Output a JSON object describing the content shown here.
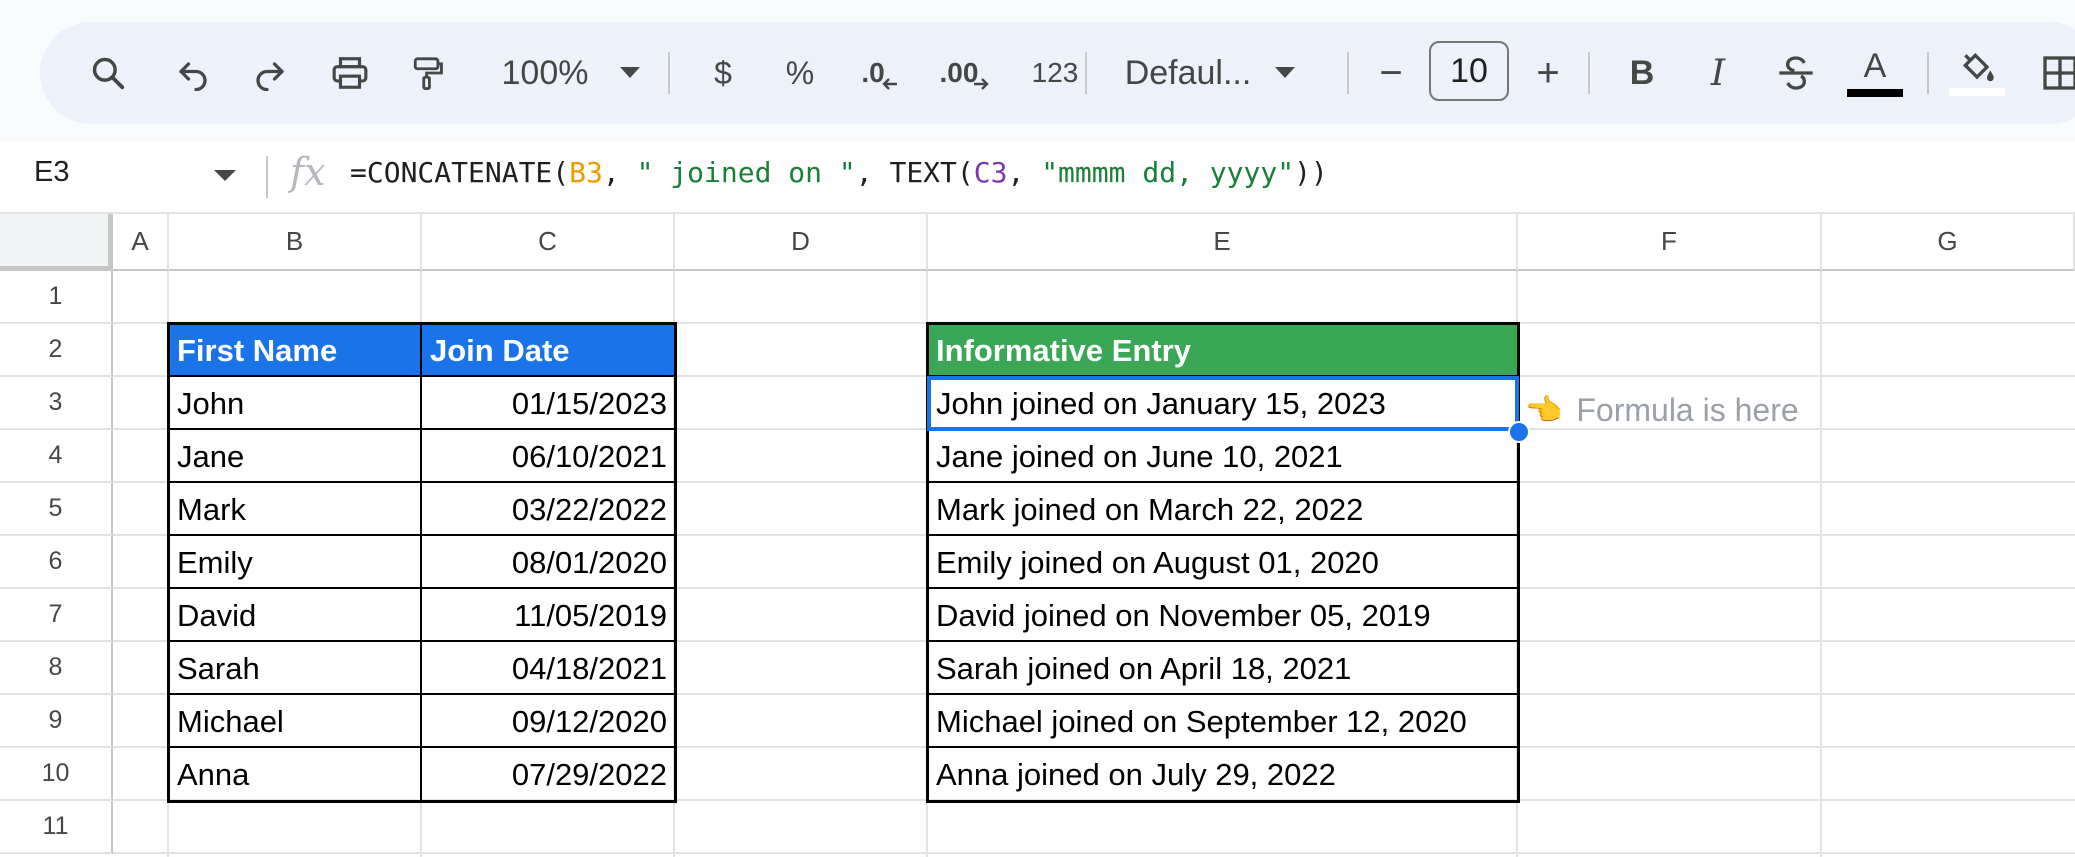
{
  "toolbar": {
    "zoom": "100%",
    "currency_label": "$",
    "percent_label": "%",
    "decrease_decimal_label": ".0",
    "increase_decimal_label": ".00",
    "number_format_label": "123",
    "font_name": "Defaul...",
    "font_size": "10",
    "decrease_font_label": "−",
    "increase_font_label": "+",
    "bold_label": "B",
    "italic_label": "I",
    "text_color_label": "A",
    "icons": [
      "search-icon",
      "undo-icon",
      "redo-icon",
      "print-icon",
      "paint-format-icon",
      "bold-icon",
      "italic-icon",
      "strikethrough-icon",
      "text-color-icon",
      "fill-color-icon",
      "borders-icon"
    ]
  },
  "formula_bar": {
    "cell_ref": "E3",
    "fx_label": "fx",
    "formula_parts": {
      "p1": "=CONCATENATE(",
      "p2": "B3",
      "p3": ", ",
      "p4": "\" joined on \"",
      "p5": ", TEXT(",
      "p6": "C3",
      "p7": ", ",
      "p8": "\"mmmm dd, yyyy\"",
      "p9": "))"
    }
  },
  "columns": [
    "A",
    "B",
    "C",
    "D",
    "E",
    "F",
    "G"
  ],
  "rows": [
    "1",
    "2",
    "3",
    "4",
    "5",
    "6",
    "7",
    "8",
    "9",
    "10",
    "11"
  ],
  "table1": {
    "headers": [
      "First Name",
      "Join Date"
    ],
    "rows": [
      [
        "John",
        "01/15/2023"
      ],
      [
        "Jane",
        "06/10/2021"
      ],
      [
        "Mark",
        "03/22/2022"
      ],
      [
        "Emily",
        "08/01/2020"
      ],
      [
        "David",
        "11/05/2019"
      ],
      [
        "Sarah",
        "04/18/2021"
      ],
      [
        "Michael",
        "09/12/2020"
      ],
      [
        "Anna",
        "07/29/2022"
      ]
    ]
  },
  "table2": {
    "header": "Informative Entry",
    "rows": [
      "John joined on January 15, 2023",
      "Jane joined on June 10, 2021",
      "Mark joined on March 22, 2022",
      "Emily joined on August 01, 2020",
      "David joined on November 05, 2019",
      "Sarah joined on April 18, 2021",
      "Michael joined on September 12, 2020",
      "Anna joined on July 29, 2022"
    ]
  },
  "annotation": {
    "hand": "👈",
    "text": "Formula is here"
  },
  "colors": {
    "header_blue": "#1a73e8",
    "header_green": "#3aa757",
    "selection": "#1a73e8",
    "formula_ref_orange": "#f29900",
    "formula_string_green": "#188038",
    "formula_ref_purple": "#7b3ab4"
  }
}
